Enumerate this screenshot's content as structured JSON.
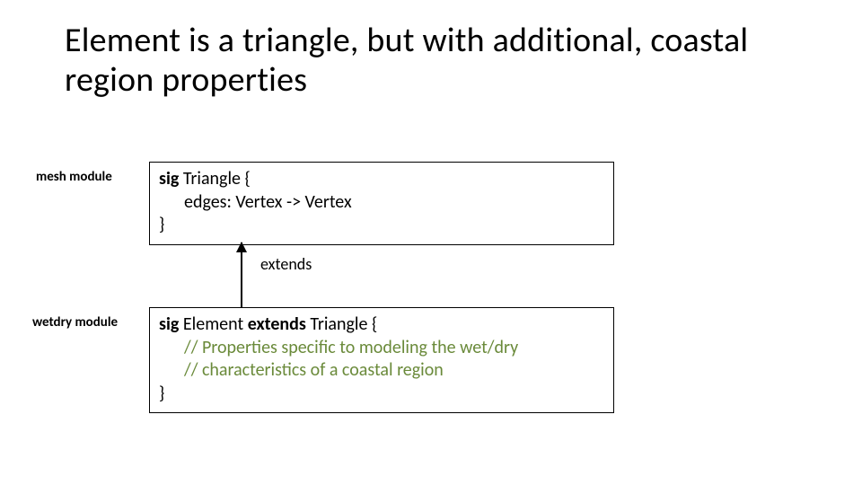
{
  "title": "Element is a triangle, but with additional, coastal region properties",
  "labels": {
    "mesh": "mesh module",
    "wetdry": "wetdry module"
  },
  "relation": "extends",
  "code_top": {
    "kw1": "sig",
    "name": " Triangle {",
    "field": "edges: Vertex -> Vertex",
    "close": "}"
  },
  "code_bot": {
    "kw1": "sig",
    "name": " Element ",
    "kw2": "extends",
    "rest": " Triangle {",
    "comment1": "// Properties specific to modeling the wet/dry",
    "comment2": "// characteristics of a coastal region",
    "close": "}"
  }
}
